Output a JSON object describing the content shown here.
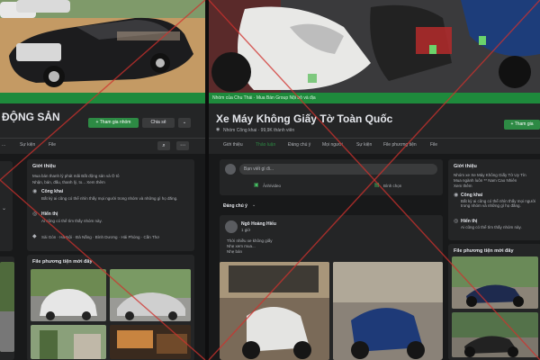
{
  "left": {
    "title_partial": "ĐỘNG SẢN",
    "buttons": {
      "join": "+ Tham gia nhóm",
      "share": "Chia sẻ",
      "more": "⌄"
    },
    "tabs": [
      "...",
      "Sự kiện",
      "File"
    ],
    "about": {
      "heading": "Giới thiệu",
      "line1": "Mua bán thanh lý phát mãi Bất động sản và Ô tô",
      "line2": "Nhận, bán, đấu, thanh lý, to... Xem thêm",
      "public_label": "Công khai",
      "public_desc": "Bất kỳ ai cũng có thể nhìn thấy mọi người trong nhóm và những gì họ đăng.",
      "visible_label": "Hiển thị",
      "visible_desc": "Ai cũng có thể tìm thấy nhóm này.",
      "tags": "Sài Gòn · Hà Nội · Đà Nẵng · Bình Dương · Hải Phòng · Cần Thơ"
    },
    "recent_files": "File phương tiện mới đây"
  },
  "right": {
    "cover_caption": "Nhóm của Chu Thái · Mua Bán Group Nội bộ và địa",
    "title": "Xe Máy Không Giấy Tờ Toàn Quốc",
    "subtitle": "Nhóm Công khai · 99,9K thành viên",
    "buttons": {
      "join": "+ Tham gia",
      "more": "⌄"
    },
    "tabs": [
      "Giới thiệu",
      "Thảo luận",
      "Đáng chú ý",
      "Mọi người",
      "Sự kiện",
      "File phương tiện",
      "File"
    ],
    "composer": {
      "placeholder": "Bạn viết gì đi...",
      "photo_action": "Ảnh/video",
      "poll_action": "Bình chọn"
    },
    "feed_filter": "Đáng chú ý",
    "post": {
      "author": "Ngô Hoàng Hiếu",
      "time": "1 giờ",
      "text_line1": "Thời nhiều xe không giấy",
      "text_line2": "Nhẹ xem mua...",
      "text_line3": "Nhẹ bán"
    },
    "about": {
      "heading": "Giới thiệu",
      "line1": "Nhóm xe Xe Máy Không Giấy Tờ Uy Tín",
      "line2": "Mua ngành luôn ** Nam Cao Nhiên",
      "line3": "Xem thêm",
      "public_label": "Công khai",
      "public_desc": "Bất kỳ ai cũng có thể nhìn thấy mọi người trong nhóm và những gì họ đăng.",
      "visible_label": "Hiển thị",
      "visible_desc": "Ai cũng có thể tìm thấy nhóm này."
    },
    "recent_files": "File phương tiện mới đây"
  },
  "colors": {
    "accent_green": "#2d8a44",
    "cover_green": "#1e8a3c",
    "dark_bg": "#18191a",
    "card_bg": "#242526",
    "strike_red": "#d0312d"
  }
}
